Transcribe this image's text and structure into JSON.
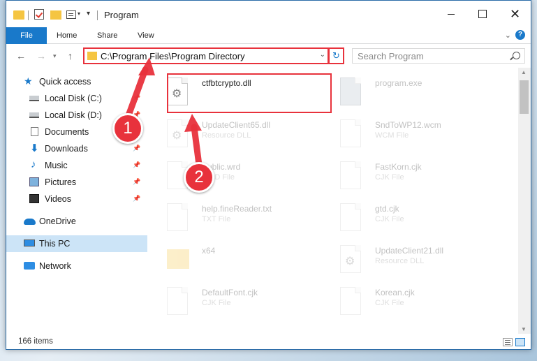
{
  "window": {
    "title": "Program"
  },
  "ribbon": {
    "tabs": [
      {
        "label": "File"
      },
      {
        "label": "Home"
      },
      {
        "label": "Share"
      },
      {
        "label": "View"
      }
    ]
  },
  "address": {
    "path": "C:\\Program Files\\Program Directory"
  },
  "search": {
    "placeholder": "Search Program"
  },
  "sidebar": {
    "items": [
      {
        "label": "Quick access",
        "icon": "star-icon"
      },
      {
        "label": "Local Disk (C:)",
        "icon": "drive-icon"
      },
      {
        "label": "Local Disk (D:)",
        "icon": "drive-icon"
      },
      {
        "label": "Documents",
        "icon": "document-icon"
      },
      {
        "label": "Downloads",
        "icon": "download-icon"
      },
      {
        "label": "Music",
        "icon": "music-icon"
      },
      {
        "label": "Pictures",
        "icon": "picture-icon"
      },
      {
        "label": "Videos",
        "icon": "video-icon"
      },
      {
        "label": "OneDrive",
        "icon": "cloud-icon"
      },
      {
        "label": "This PC",
        "icon": "computer-icon",
        "selected": true
      },
      {
        "label": "Network",
        "icon": "network-icon"
      }
    ]
  },
  "files": [
    {
      "name": "ctfbtcrypto.dll",
      "type": "",
      "highlighted": true
    },
    {
      "name": "program.exe",
      "type": ""
    },
    {
      "name": "UpdateClient65.dll",
      "type": "Resource DLL"
    },
    {
      "name": "SndToWP12.wcm",
      "type": "WCM File"
    },
    {
      "name": "Public.wrd",
      "type": "WRD File"
    },
    {
      "name": "FastKorn.cjk",
      "type": "CJK File"
    },
    {
      "name": "help.fineReader.txt",
      "type": "TXT File"
    },
    {
      "name": "gtd.cjk",
      "type": "CJK File"
    },
    {
      "name": "x64",
      "type": ""
    },
    {
      "name": "UpdateClient21.dll",
      "type": "Resource DLL"
    },
    {
      "name": "DefaultFont.cjk",
      "type": "CJK File"
    },
    {
      "name": "Korean.cjk",
      "type": "CJK File"
    }
  ],
  "status": {
    "item_count": "166 items"
  },
  "annotations": {
    "badge1": "1",
    "badge2": "2",
    "color": "#e8323c"
  }
}
